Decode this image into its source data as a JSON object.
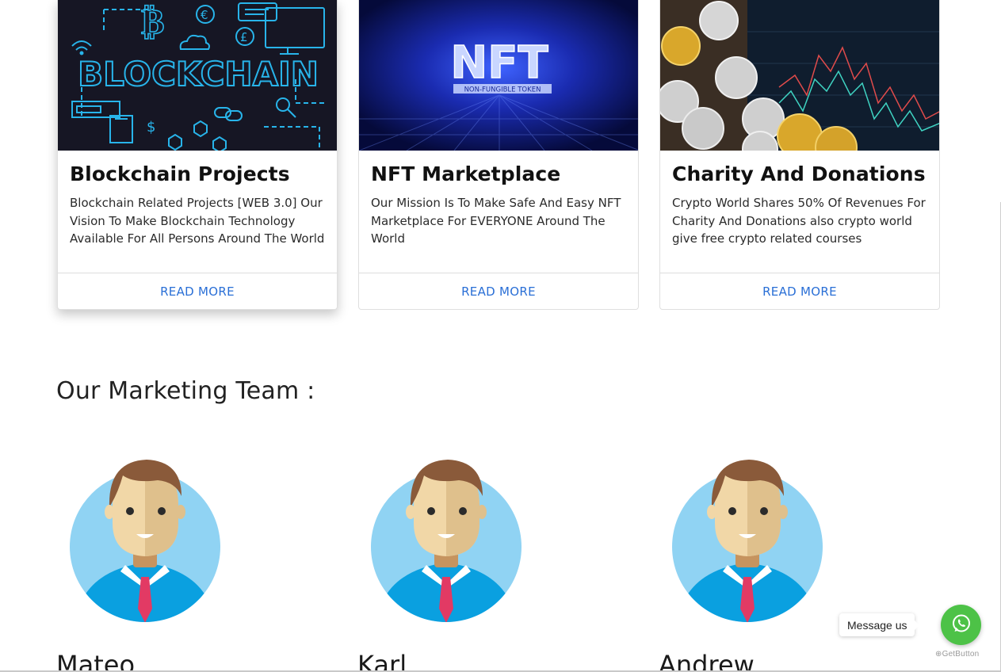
{
  "cards": [
    {
      "title": "Blockchain Projects",
      "text": "Blockchain Related Projects [WEB 3.0] Our Vision To Make Blockchain Technology Available For All Persons Around The World",
      "cta": "READ MORE",
      "image_text": "BLOCKCHAIN"
    },
    {
      "title": "NFT Marketplace",
      "text": "Our Mission Is To Make Safe And Easy NFT Marketplace For EVERYONE Around The World",
      "cta": "READ MORE",
      "image_text": "NFT",
      "image_subtext": "NON-FUNGIBLE TOKEN"
    },
    {
      "title": "Charity And Donations",
      "text": "Crypto World Shares 50% Of Revenues For Charity And Donations also crypto world give free crypto related courses",
      "cta": "READ MORE"
    }
  ],
  "team": {
    "title": "Our Marketing Team :",
    "members": [
      {
        "name": "Mateo"
      },
      {
        "name": "Karl"
      },
      {
        "name": "Andrew"
      }
    ]
  },
  "widget": {
    "message_label": "Message us",
    "brand": "GetButton",
    "icon": "whatsapp-icon"
  },
  "colors": {
    "link": "#2a6fd6",
    "whatsapp": "#4dc247",
    "avatar_bg": "#90d3f3"
  }
}
